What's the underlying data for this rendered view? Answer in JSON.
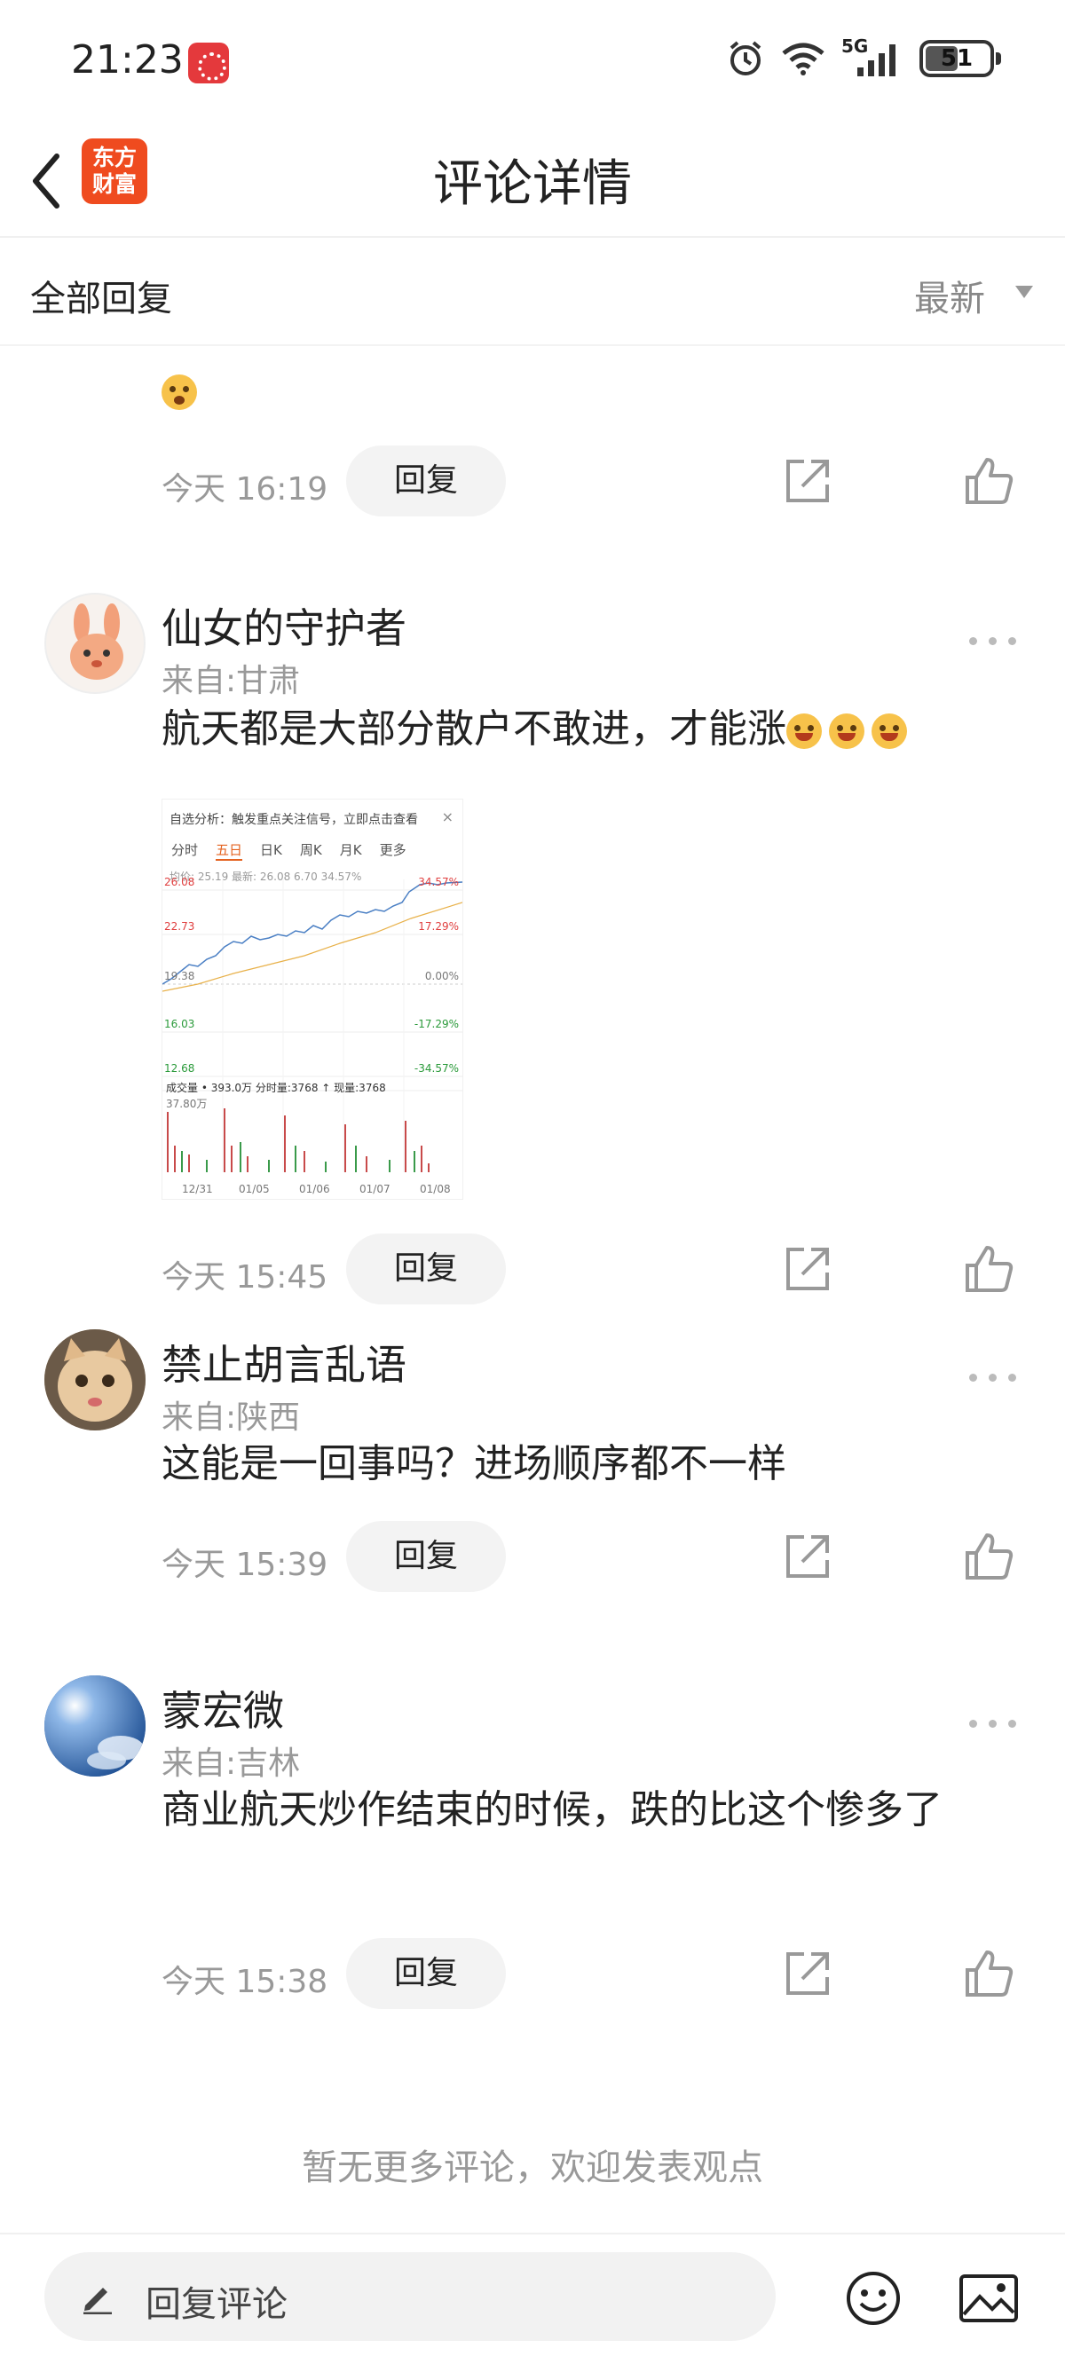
{
  "status_bar": {
    "time": "21:23",
    "network": "5G",
    "battery": "51"
  },
  "header": {
    "title": "评论详情",
    "logo_line1": "东方",
    "logo_line2": "财富"
  },
  "filter": {
    "all_label": "全部回复",
    "sort_label": "最新"
  },
  "partial_comment": {
    "time": "今天 16:19",
    "reply_label": "回复"
  },
  "comments": [
    {
      "username": "仙女的守护者",
      "location": "来自:甘肃",
      "text": "航天都是大部分散户不敢进，才能涨",
      "time": "今天 15:45",
      "reply_label": "回复",
      "emoji_count": 3,
      "image": {
        "banner": "自选分析：触发重点关注信号，立即点击查看",
        "tabs": [
          "分时",
          "五日",
          "日K",
          "周K",
          "月K",
          "更多"
        ],
        "active_tab": "五日",
        "info": "均价: 25.19  最新: 26.08  6.70  34.57%",
        "price_labels": [
          "26.08",
          "22.73",
          "19.38",
          "16.03",
          "12.68"
        ],
        "pct_labels": [
          "34.57%",
          "17.29%",
          "0.00%",
          "-17.29%",
          "-34.57%"
        ],
        "volume_info": "成交量 • 393.0万   分时量:3768 ↑   现量:3768",
        "volume_max": "37.80万",
        "dates": [
          "12/31",
          "01/05",
          "01/06",
          "01/07",
          "01/08"
        ]
      }
    },
    {
      "username": "禁止胡言乱语",
      "location": "来自:陕西",
      "text": "这能是一回事吗？进场顺序都不一样",
      "time": "今天 15:39",
      "reply_label": "回复"
    },
    {
      "username": "蒙宏微",
      "location": "来自:吉林",
      "text": "商业航天炒作结束的时候，跌的比这个惨多了",
      "time": "今天 15:38",
      "reply_label": "回复"
    }
  ],
  "footer": {
    "no_more": "暂无更多评论，欢迎发表观点"
  },
  "bottom_bar": {
    "placeholder": "回复评论"
  },
  "colors": {
    "accent": "#ef4b1f",
    "meta_gray": "#999999",
    "reply_bg": "#f3f3f3"
  }
}
